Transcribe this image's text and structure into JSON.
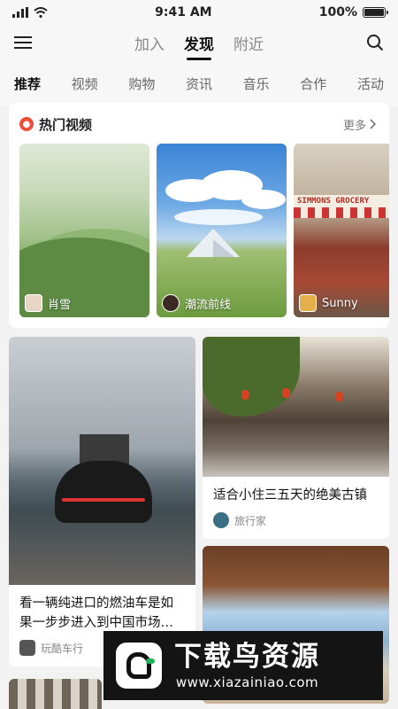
{
  "status_bar": {
    "time": "9:41 AM",
    "battery": "100%"
  },
  "top_nav": {
    "tabs": [
      "加入",
      "发现",
      "附近"
    ],
    "active_index": 1
  },
  "categories": {
    "items": [
      "推荐",
      "视频",
      "购物",
      "资讯",
      "音乐",
      "合作",
      "活动"
    ],
    "active_index": 0
  },
  "hot_videos": {
    "title": "热门视频",
    "more_label": "更多",
    "items": [
      {
        "author": "肖雪"
      },
      {
        "author": "潮流前线"
      },
      {
        "author": "Sunny",
        "sign_text": "SIMMONS GROCERY"
      }
    ]
  },
  "feed": {
    "left": [
      {
        "title": "看一辆纯进口的燃油车是如果一步步进入到中国市场…",
        "author": "玩酷车行"
      }
    ],
    "right": [
      {
        "title": "适合小住三五天的绝美古镇",
        "author": "旅行家"
      }
    ]
  },
  "watermark": {
    "brand": "下载鸟资源",
    "url": "www.xiazainiao.com"
  },
  "colors": {
    "accent": "#111111",
    "fire": "#ef4e3b",
    "background": "#f2f2f2"
  }
}
